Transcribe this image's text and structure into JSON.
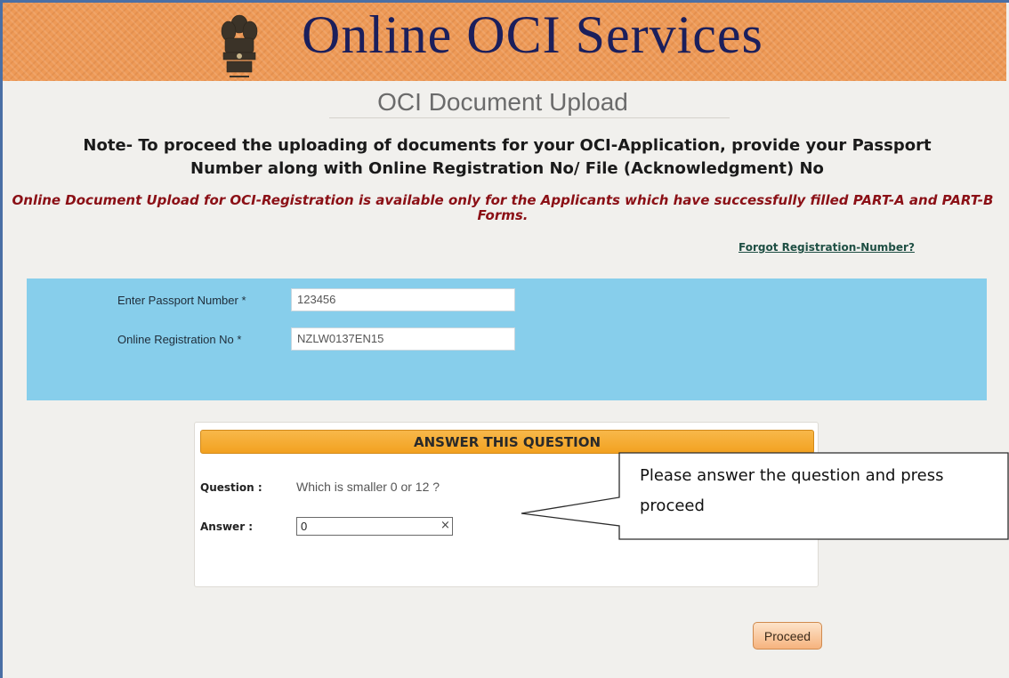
{
  "header": {
    "title": "Online OCI Services",
    "emblem_icon": "national-emblem-icon",
    "background_color": "#ee9a57"
  },
  "page": {
    "subtitle": "OCI Document Upload",
    "note": "Note- To proceed the uploading of documents for your OCI-Application, provide your Passport Number along with Online Registration No/ File (Acknowledgment) No",
    "warning": "Online Document Upload for OCI-Registration is available only for the Applicants which have successfully filled PART-A and PART-B Forms.",
    "forgot_link": "Forgot Registration-Number?"
  },
  "form": {
    "passport_label": "Enter Passport Number *",
    "passport_value": "123456",
    "registration_label": "Online Registration No *",
    "registration_value": "NZLW0137EN15"
  },
  "question": {
    "header": "ANSWER THIS QUESTION",
    "question_label": "Question :",
    "question_text": "Which is smaller 0 or 12 ?",
    "answer_label": "Answer :",
    "answer_value": "0",
    "clear_symbol": "×"
  },
  "actions": {
    "proceed_label": "Proceed"
  },
  "callout": {
    "text": "Please answer the question and press proceed"
  },
  "colors": {
    "panel_blue": "#87ceeb",
    "warning_red": "#8b1016",
    "title_navy": "#1b1f5c"
  }
}
